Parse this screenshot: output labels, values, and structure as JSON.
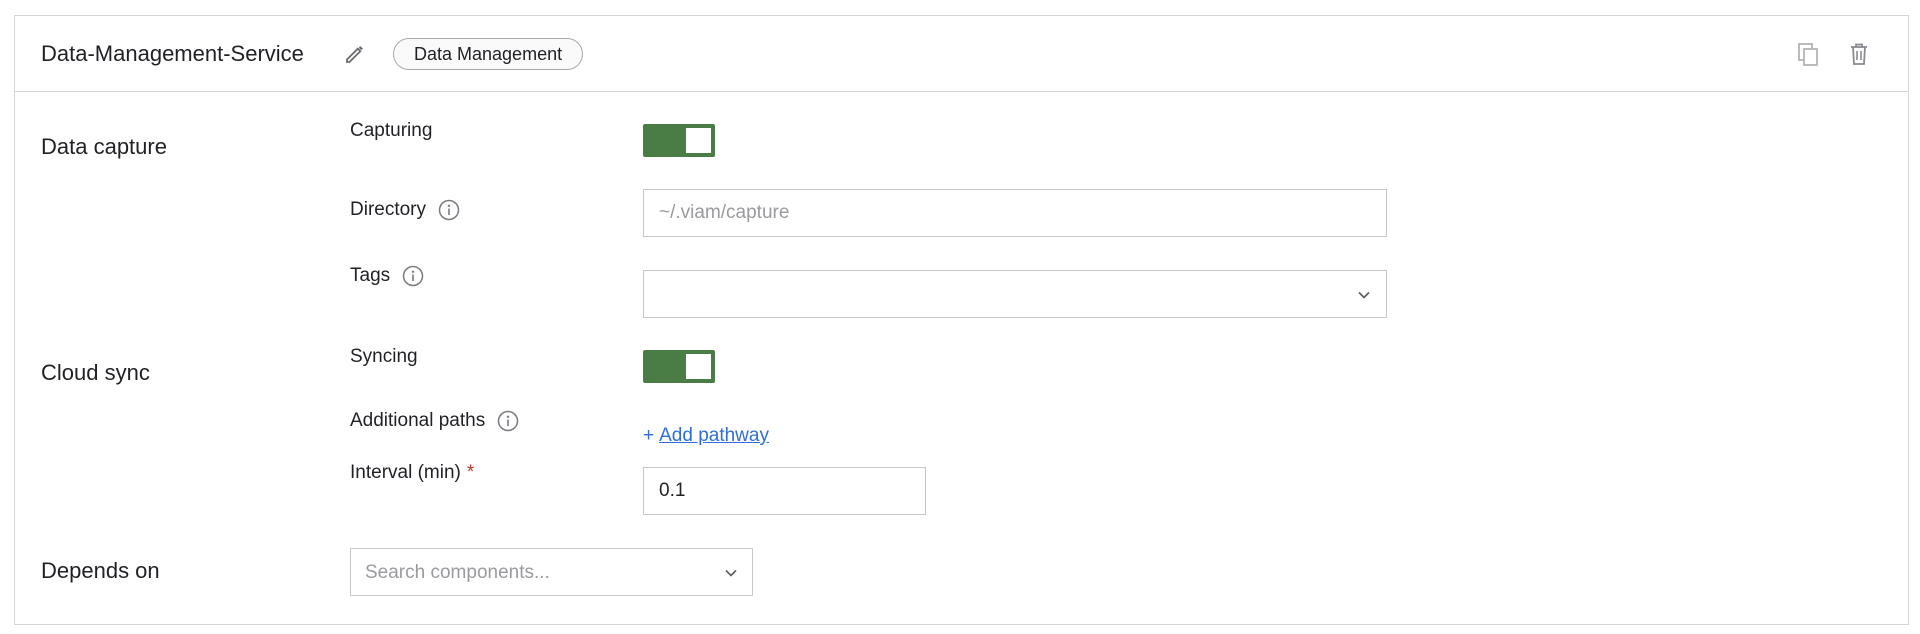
{
  "header": {
    "title": "Data-Management-Service",
    "badge": "Data Management",
    "icons": {
      "edit": "pencil-icon",
      "duplicate": "copy-icon",
      "delete": "trash-icon"
    }
  },
  "sections": {
    "data_capture": {
      "label": "Data capture",
      "capturing": {
        "label": "Capturing",
        "enabled": true
      },
      "directory": {
        "label": "Directory",
        "value": "",
        "placeholder": "~/.viam/capture"
      },
      "tags": {
        "label": "Tags",
        "value": ""
      }
    },
    "cloud_sync": {
      "label": "Cloud sync",
      "syncing": {
        "label": "Syncing",
        "enabled": true
      },
      "additional_paths": {
        "label": "Additional paths",
        "link_plus": "+",
        "link_label": "Add pathway"
      },
      "interval": {
        "label": "Interval (min)",
        "required_mark": "*",
        "value": "0.1"
      }
    },
    "depends_on": {
      "label": "Depends on",
      "placeholder": "Search components..."
    }
  },
  "colors": {
    "toggle_on": "#4a7c45",
    "link": "#2f6fd6",
    "required": "#c0392b",
    "border": "#d6d6da"
  }
}
